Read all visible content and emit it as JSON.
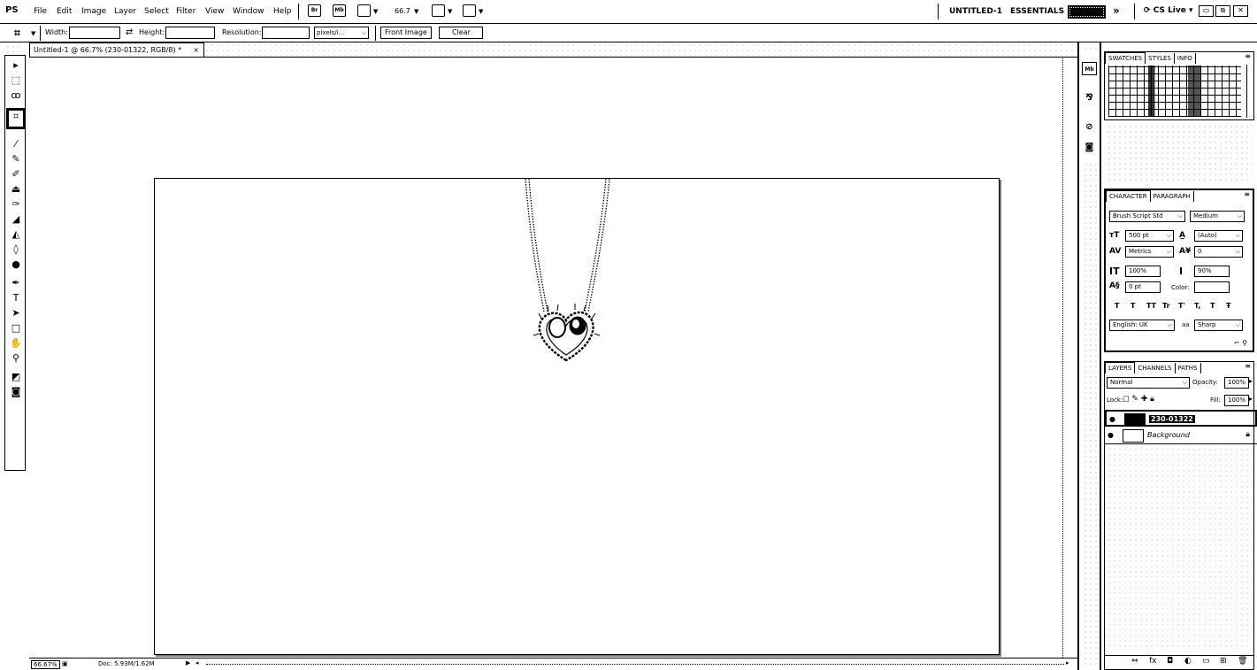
{
  "app": {
    "logo": "PS"
  },
  "menu": [
    "File",
    "Edit",
    "Image",
    "Layer",
    "Select",
    "Filter",
    "View",
    "Window",
    "Help"
  ],
  "appbar": {
    "bridge_icon": "Br",
    "minibridge_icon": "Mb",
    "zoom": "66.7",
    "workspace_current": "UNTITLED-1",
    "workspace_essentials": "ESSENTIALS",
    "more": "»",
    "cslive": "CS Live",
    "window_buttons": [
      "▭",
      "⧉",
      "✕"
    ]
  },
  "options": {
    "width_label": "Width:",
    "height_label": "Height:",
    "resolution_label": "Resolution:",
    "units": "pixels/i...",
    "front_image": "Front Image",
    "clear": "Clear"
  },
  "document": {
    "tab_title": "Untitled-1 @ 66.7% (230-01322, RGB/8) *",
    "close": "×"
  },
  "status": {
    "zoom": "66.67%",
    "doc": "Doc: 5.93M/1.62M"
  },
  "tools": [
    {
      "name": "move-tool-icon",
      "glyph": "▸"
    },
    {
      "name": "marquee-tool-icon",
      "glyph": "⬚"
    },
    {
      "name": "lasso-tool-icon",
      "glyph": "ꝏ"
    },
    {
      "name": "crop-tool-icon",
      "glyph": "⌗"
    },
    {
      "name": "eyedropper-tool-icon",
      "glyph": "⁄"
    },
    {
      "name": "healing-brush-tool-icon",
      "glyph": "✎"
    },
    {
      "name": "brush-tool-icon",
      "glyph": "✐"
    },
    {
      "name": "clone-stamp-tool-icon",
      "glyph": "⏏"
    },
    {
      "name": "history-brush-tool-icon",
      "glyph": "✑"
    },
    {
      "name": "eraser-tool-icon",
      "glyph": "◢"
    },
    {
      "name": "paint-bucket-tool-icon",
      "glyph": "◭"
    },
    {
      "name": "blur-tool-icon",
      "glyph": "◊"
    },
    {
      "name": "dodge-tool-icon",
      "glyph": "●"
    },
    {
      "name": "pen-tool-icon",
      "glyph": "✒"
    },
    {
      "name": "type-tool-icon",
      "glyph": "T"
    },
    {
      "name": "path-selection-tool-icon",
      "glyph": "➤"
    },
    {
      "name": "shape-tool-icon",
      "glyph": "□"
    },
    {
      "name": "hand-tool-icon",
      "glyph": "✋"
    },
    {
      "name": "zoom-tool-icon",
      "glyph": "⚲"
    },
    {
      "name": "color-swatch-icon",
      "glyph": "◩"
    },
    {
      "name": "quick-mask-icon",
      "glyph": "◙"
    }
  ],
  "panels": {
    "top_tabs": [
      "SWATCHES",
      "STYLES",
      "INFO"
    ],
    "char_tabs": [
      "CHARACTER",
      "PARAGRAPH"
    ],
    "layer_tabs": [
      "LAYERS",
      "CHANNELS",
      "PATHS"
    ]
  },
  "character": {
    "font_family": "Brush Script Std",
    "font_style": "Medium",
    "size": "500 pt",
    "leading": "(Auto)",
    "kerning": "Metrics",
    "tracking": "0",
    "vscale": "100%",
    "hscale": "90%",
    "baseline": "0 pt",
    "color_label": "Color:",
    "styles": [
      "T",
      "T",
      "TT",
      "Tr",
      "T'",
      "T,",
      "T",
      "Ŧ"
    ],
    "language": "English: UK",
    "aa_label": "aa",
    "antialias": "Sharp"
  },
  "layers": {
    "blend": "Normal",
    "opacity_label": "Opacity:",
    "opacity": "100%",
    "lock_label": "Lock:",
    "fill_label": "Fill:",
    "fill": "100%",
    "items": [
      {
        "name": "230-01322",
        "selected": true
      },
      {
        "name": "Background",
        "selected": false
      }
    ],
    "footer_icons": [
      "⇔",
      "fx",
      "◘",
      "◐",
      "▭",
      "⊞",
      "🗑"
    ]
  }
}
